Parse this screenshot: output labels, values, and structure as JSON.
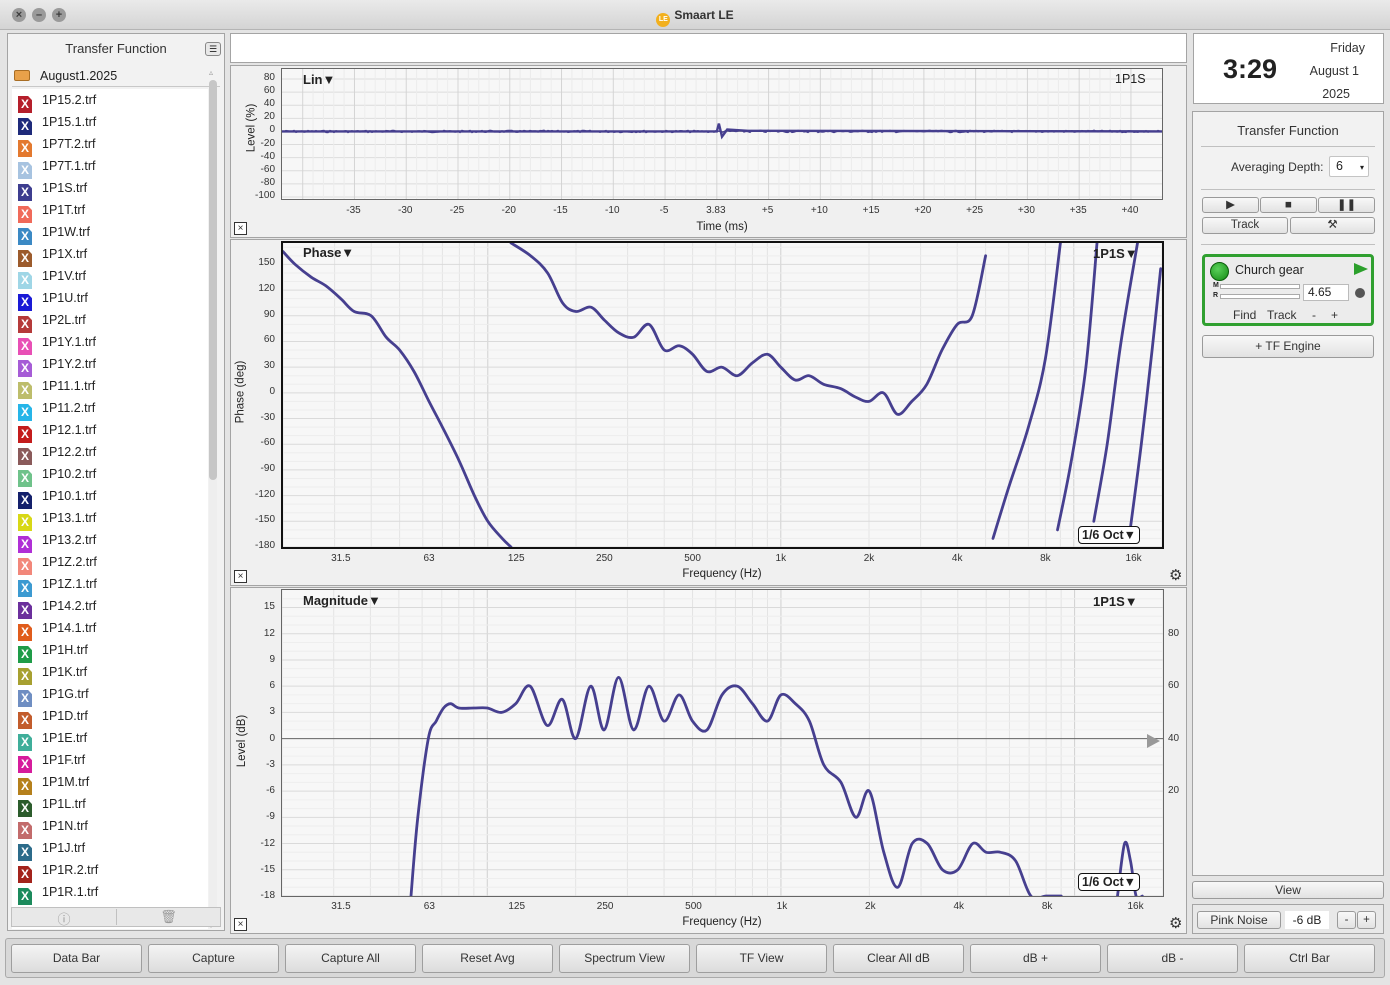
{
  "window": {
    "title": "Smaart LE"
  },
  "sidebar": {
    "title": "Transfer Function",
    "folder": "August1.2025",
    "files": [
      {
        "name": "1P15.2.trf",
        "color": "#b51f2b"
      },
      {
        "name": "1P15.1.trf",
        "color": "#1e2a7a"
      },
      {
        "name": "1P7T.2.trf",
        "color": "#e3792f"
      },
      {
        "name": "1P7T.1.trf",
        "color": "#a7c3e0"
      },
      {
        "name": "1P1S.trf",
        "color": "#3d3d8f"
      },
      {
        "name": "1P1T.trf",
        "color": "#f06a5a"
      },
      {
        "name": "1P1W.trf",
        "color": "#3b89c4"
      },
      {
        "name": "1P1X.trf",
        "color": "#9c5b2c"
      },
      {
        "name": "1P1V.trf",
        "color": "#9fd6e6"
      },
      {
        "name": "1P1U.trf",
        "color": "#1a1ad6"
      },
      {
        "name": "1P2L.trf",
        "color": "#b53a3a"
      },
      {
        "name": "1P1Y.1.trf",
        "color": "#e84fb5"
      },
      {
        "name": "1P1Y.2.trf",
        "color": "#a65cd6"
      },
      {
        "name": "1P11.1.trf",
        "color": "#bdbd6b"
      },
      {
        "name": "1P11.2.trf",
        "color": "#26b5e8"
      },
      {
        "name": "1P12.1.trf",
        "color": "#c41c1c"
      },
      {
        "name": "1P12.2.trf",
        "color": "#8a5a5a"
      },
      {
        "name": "1P10.2.trf",
        "color": "#6fc28a"
      },
      {
        "name": "1P10.1.trf",
        "color": "#14206b"
      },
      {
        "name": "1P13.1.trf",
        "color": "#d8d816"
      },
      {
        "name": "1P13.2.trf",
        "color": "#b02fd6"
      },
      {
        "name": "1P1Z.2.trf",
        "color": "#f2877a"
      },
      {
        "name": "1P1Z.1.trf",
        "color": "#3c9ad1"
      },
      {
        "name": "1P14.2.trf",
        "color": "#6b2f9c"
      },
      {
        "name": "1P14.1.trf",
        "color": "#e05c1c"
      },
      {
        "name": "1P1H.trf",
        "color": "#1f9c48"
      },
      {
        "name": "1P1K.trf",
        "color": "#a7a030"
      },
      {
        "name": "1P1G.trf",
        "color": "#6f8ec2"
      },
      {
        "name": "1P1D.trf",
        "color": "#c25c2c"
      },
      {
        "name": "1P1E.trf",
        "color": "#3fae9a"
      },
      {
        "name": "1P1F.trf",
        "color": "#d61c9c"
      },
      {
        "name": "1P1M.trf",
        "color": "#b5801c"
      },
      {
        "name": "1P1L.trf",
        "color": "#2c5c2c"
      },
      {
        "name": "1P1N.trf",
        "color": "#c26b6b"
      },
      {
        "name": "1P1J.trf",
        "color": "#2c6b8a"
      },
      {
        "name": "1P1R.2.trf",
        "color": "#a3231c"
      },
      {
        "name": "1P1R.1.trf",
        "color": "#1c8a5c"
      }
    ],
    "icon_glyph": "X"
  },
  "impulse": {
    "title": "Lin▼",
    "measurement": "1P1S",
    "ylabel": "Level (%)",
    "xlabel": "Time (ms)",
    "yticks": [
      "80",
      "60",
      "40",
      "20",
      "0",
      "-20",
      "-40",
      "-60",
      "-80",
      "-100"
    ],
    "yvals": [
      80,
      60,
      40,
      20,
      0,
      -20,
      -40,
      -60,
      -80,
      -100
    ],
    "xticks": [
      "-35",
      "-30",
      "-25",
      "-20",
      "-15",
      "-10",
      "-5",
      "3.83",
      "+5",
      "+10",
      "+15",
      "+20",
      "+25",
      "+30",
      "+35",
      "+40"
    ],
    "xvals": [
      -35,
      -30,
      -25,
      -20,
      -15,
      -10,
      -5,
      0,
      5,
      10,
      15,
      20,
      25,
      30,
      35,
      40
    ],
    "xlim": [
      -42,
      43
    ],
    "ylim": [
      -100,
      90
    ]
  },
  "phase": {
    "title": "Phase▼",
    "measurement": "1P1S▼",
    "smoothing": "1/6 Oct▼",
    "ylabel": "Phase (deg)",
    "xlabel": "Frequency (Hz)",
    "yticks": [
      "150",
      "120",
      "90",
      "60",
      "30",
      "0",
      "-30",
      "-60",
      "-90",
      "-120",
      "-150",
      "-180"
    ],
    "yvals": [
      150,
      120,
      90,
      60,
      30,
      0,
      -30,
      -60,
      -90,
      -120,
      -150,
      -180
    ],
    "xticks": [
      "31.5",
      "63",
      "125",
      "250",
      "500",
      "1k",
      "2k",
      "4k",
      "8k",
      "16k"
    ],
    "xvals": [
      31.5,
      63,
      125,
      250,
      500,
      1000,
      2000,
      4000,
      8000,
      16000
    ],
    "xlim": [
      20,
      20000
    ],
    "ylim": [
      -180,
      175
    ]
  },
  "magnitude": {
    "title": "Magnitude▼",
    "measurement": "1P1S▼",
    "smoothing": "1/6 Oct▼",
    "ylabel": "Level (dB)",
    "xlabel": "Frequency (Hz)",
    "yticks": [
      "15",
      "12",
      "9",
      "6",
      "3",
      "0",
      "-3",
      "-6",
      "-9",
      "-12",
      "-15",
      "-18"
    ],
    "yvals": [
      15,
      12,
      9,
      6,
      3,
      0,
      -3,
      -6,
      -9,
      -12,
      -15,
      -18
    ],
    "ryticks": [
      "80",
      "60",
      "40",
      "20"
    ],
    "ryvals": [
      12,
      6,
      0,
      -6
    ],
    "xticks": [
      "31.5",
      "63",
      "125",
      "250",
      "500",
      "1k",
      "2k",
      "4k",
      "8k",
      "16k"
    ],
    "xvals": [
      31.5,
      63,
      125,
      250,
      500,
      1000,
      2000,
      4000,
      8000,
      16000
    ],
    "xlim": [
      20,
      20000
    ],
    "ylim": [
      -18,
      17
    ]
  },
  "chart_data": [
    {
      "type": "line",
      "title": "Lin",
      "xlabel": "Time (ms)",
      "ylabel": "Level (%)",
      "xlim": [
        -42,
        43
      ],
      "ylim": [
        -100,
        90
      ],
      "series": [
        {
          "name": "1P1S",
          "x": [
            -42,
            -10,
            0,
            0.2,
            0.5,
            1,
            3,
            43
          ],
          "y": [
            0,
            0,
            0,
            12,
            -8,
            3,
            1,
            0
          ]
        }
      ]
    },
    {
      "type": "line",
      "title": "Phase",
      "xlabel": "Frequency (Hz)",
      "ylabel": "Phase (deg)",
      "xlim": [
        20,
        20000
      ],
      "ylim": [
        -180,
        175
      ],
      "series": [
        {
          "name": "1P1S",
          "x": [
            20,
            22,
            25,
            28,
            31.5,
            35,
            40,
            45,
            50,
            56,
            63,
            70,
            80,
            90,
            100,
            112,
            120
          ],
          "y": [
            165,
            150,
            135,
            125,
            110,
            95,
            90,
            65,
            50,
            25,
            -10,
            -40,
            -80,
            -120,
            -150,
            -170,
            -180
          ]
        },
        {
          "name": "1P1S",
          "x": [
            120,
            140,
            160,
            180,
            200,
            225,
            250,
            280,
            315,
            355,
            400,
            450,
            500,
            560,
            630,
            710,
            800,
            900,
            1000,
            1120,
            1250,
            1400,
            1600,
            1800,
            2000,
            2240,
            2500,
            2800,
            3150,
            3550,
            4000,
            4500,
            5000
          ],
          "y": [
            175,
            160,
            140,
            105,
            95,
            100,
            85,
            70,
            65,
            80,
            50,
            55,
            45,
            25,
            30,
            20,
            35,
            45,
            30,
            15,
            20,
            10,
            5,
            -5,
            -10,
            0,
            -25,
            -10,
            10,
            50,
            80,
            90,
            160
          ]
        },
        {
          "name": "1P1S",
          "x": [
            5300,
            6000,
            7000,
            8000,
            9000
          ],
          "y": [
            -170,
            -110,
            -40,
            40,
            175
          ]
        },
        {
          "name": "1P1S",
          "x": [
            8800,
            9800,
            11000,
            12000
          ],
          "y": [
            -160,
            -80,
            30,
            175
          ]
        },
        {
          "name": "1P1S",
          "x": [
            11700,
            13000,
            14500,
            16500
          ],
          "y": [
            -150,
            -60,
            60,
            175
          ]
        },
        {
          "name": "1P1S",
          "x": [
            15500,
            17000,
            18500,
            19800
          ],
          "y": [
            -165,
            -60,
            50,
            145
          ]
        }
      ]
    },
    {
      "type": "line",
      "title": "Magnitude",
      "xlabel": "Frequency (Hz)",
      "ylabel": "Level (dB)",
      "xlim": [
        20,
        20000
      ],
      "ylim": [
        -18,
        17
      ],
      "series": [
        {
          "name": "1P1S",
          "x": [
            55,
            58,
            63,
            67,
            71,
            75,
            80,
            90,
            100,
            112,
            125,
            140,
            160,
            180,
            200,
            225,
            250,
            280,
            315,
            355,
            400,
            450,
            500,
            560,
            630,
            710,
            800,
            900,
            1000,
            1120,
            1250,
            1400,
            1600,
            1800,
            2000,
            2240,
            2500,
            2800,
            3150,
            3550,
            4000,
            4500,
            5000,
            5600,
            6300,
            7100,
            8000,
            9000
          ],
          "y": [
            -18,
            -9,
            0,
            2,
            3.5,
            4,
            3.5,
            3.5,
            3.5,
            3,
            4,
            6,
            1.5,
            4.5,
            0,
            6,
            1,
            7,
            1,
            6,
            2,
            5,
            2,
            1,
            5,
            6,
            4,
            2,
            5,
            4,
            2,
            -3,
            -5,
            -9,
            -6,
            -13,
            -17,
            -12,
            -12,
            -15,
            -15,
            -12,
            -13,
            -13,
            -14,
            -18,
            -18,
            -18
          ]
        },
        {
          "name": "1P1S",
          "x": [
            14000,
            14800,
            15500,
            16200,
            17000
          ],
          "y": [
            -18,
            -12,
            -14,
            -18,
            -18
          ]
        }
      ]
    }
  ],
  "clock": {
    "time": "3:29",
    "day": "Friday",
    "monthday": "August 1",
    "year": "2025"
  },
  "tf_panel": {
    "title": "Transfer Function",
    "averaging_label": "Averaging Depth:",
    "averaging_value": "6",
    "track_label": "Track",
    "engine": {
      "name": "Church gear",
      "m_label": "M",
      "r_label": "R",
      "delay_value": "4.65",
      "find_label": "Find",
      "track_label": "Track",
      "minus_label": "-",
      "plus_label": "+"
    },
    "add_engine_label": "+ TF Engine"
  },
  "right_bottom": {
    "view_label": "View",
    "pink_noise_label": "Pink Noise",
    "gen_level": "-6 dB",
    "minus_label": "-",
    "plus_label": "+"
  },
  "bottom_bar": {
    "buttons": [
      "Data Bar",
      "Capture",
      "Capture All",
      "Reset Avg",
      "Spectrum View",
      "TF View",
      "Clear All dB",
      "dB +",
      "dB -",
      "Ctrl Bar"
    ]
  },
  "colors": {
    "trace": "#463f8f",
    "engine_border": "#30a030",
    "play_arrow": "#2ca02c"
  }
}
